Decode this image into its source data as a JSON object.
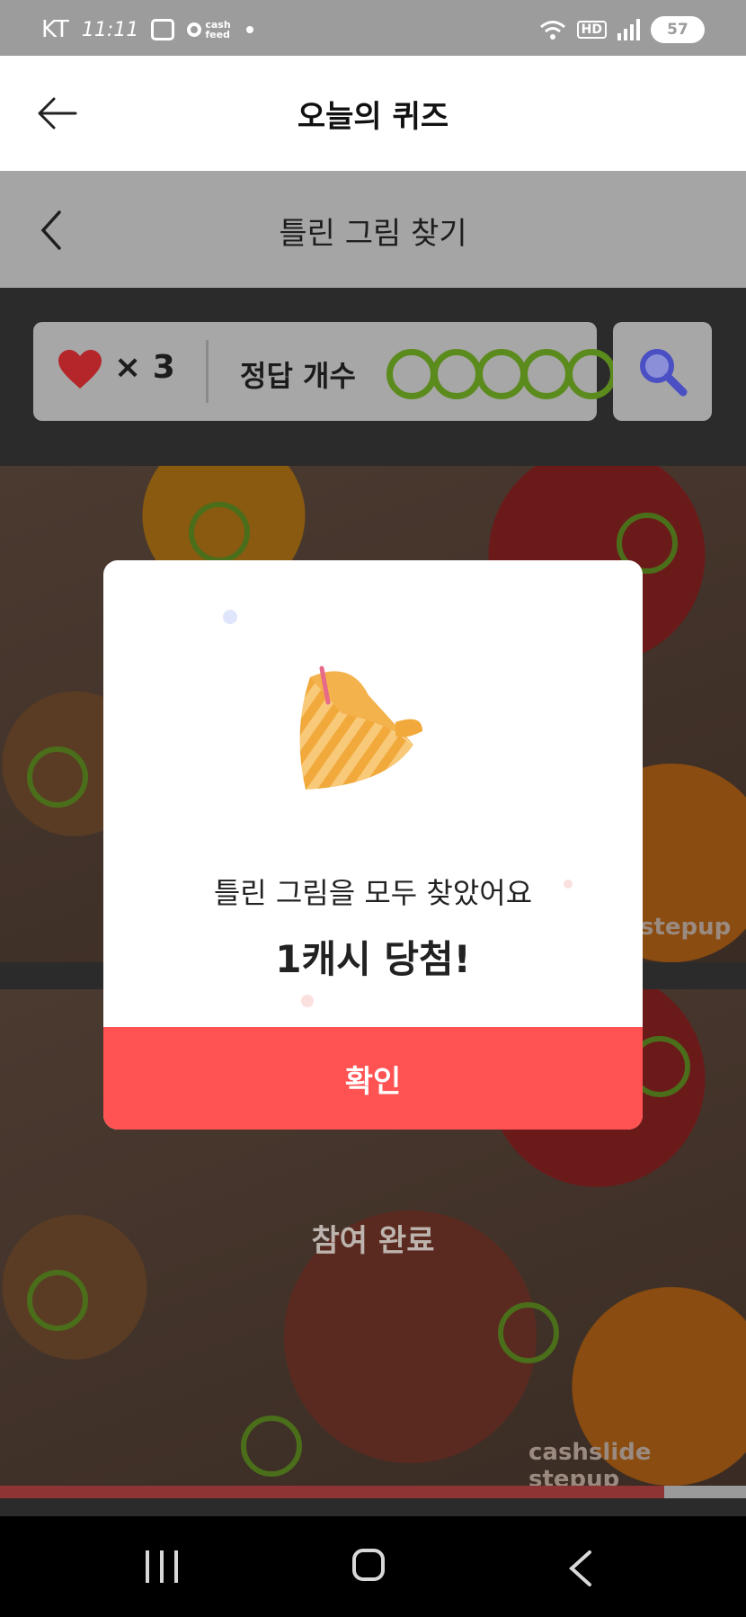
{
  "status_bar": {
    "carrier": "KT",
    "clock": "11:11",
    "cash_feed_label": "cash feed",
    "hd_label": "HD",
    "battery": "57"
  },
  "header": {
    "title": "오늘의 퀴즈"
  },
  "game": {
    "subtitle": "틀린 그림 찾기",
    "lives_text": "× 3",
    "answer_label": "정답 개수",
    "answers_found": 5,
    "answers_total": 5,
    "watermark": "cashslide stepup",
    "watermark_short": "stepup",
    "done_label": "참여 완료",
    "progress": 0.89
  },
  "modal": {
    "message": "틀린 그림을 모두 찾았어요",
    "reward": "1캐시 당첨!",
    "confirm_label": "확인"
  },
  "colors": {
    "accent": "#ff5252",
    "answer_ring": "#5c8b1d",
    "search_icon": "#4b4fc4"
  }
}
